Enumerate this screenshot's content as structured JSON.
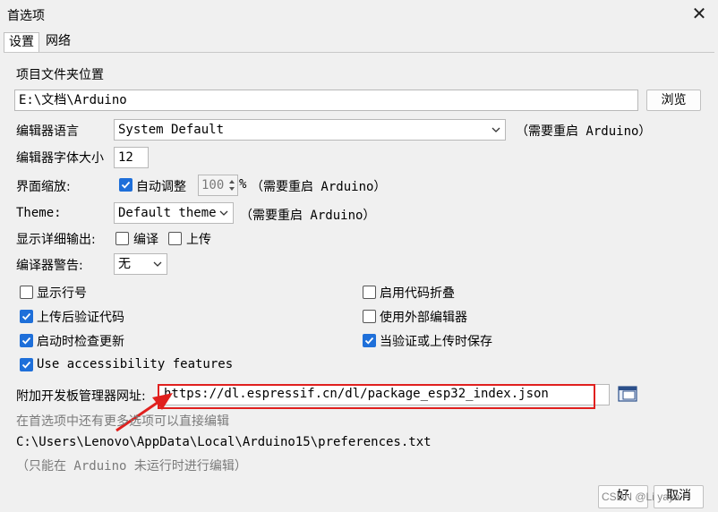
{
  "window": {
    "title": "首选项",
    "close_glyph": "✕"
  },
  "tabs": [
    {
      "label": "设置",
      "active": true
    },
    {
      "label": "网络",
      "active": false
    }
  ],
  "sketchbook": {
    "label": "项目文件夹位置",
    "value": "E:\\文档\\Arduino",
    "browse_label": "浏览"
  },
  "editor_language": {
    "label": "编辑器语言",
    "value": "System Default",
    "note": "（需要重启 Arduino）"
  },
  "editor_font_size": {
    "label": "编辑器字体大小",
    "value": "12"
  },
  "interface_scale": {
    "label": "界面缩放:",
    "auto_label": "自动调整",
    "value": "100",
    "unit": "%",
    "note": "（需要重启 Arduino）"
  },
  "theme": {
    "label": "Theme:",
    "value": "Default theme",
    "note": "（需要重启 Arduino）"
  },
  "verbose": {
    "label": "显示详细输出:",
    "compile_label": "编译",
    "upload_label": "上传"
  },
  "compiler_warnings": {
    "label": "编译器警告:",
    "value": "无"
  },
  "options": {
    "show_line_numbers": "显示行号",
    "enable_code_folding": "启用代码折叠",
    "verify_after_upload": "上传后验证代码",
    "use_external_editor": "使用外部编辑器",
    "check_updates": "启动时检查更新",
    "save_on_verify": "当验证或上传时保存",
    "accessibility": "Use accessibility features"
  },
  "board_urls": {
    "label": "附加开发板管理器网址:",
    "value": "https://dl.espressif.cn/dl/package_esp32_index.json"
  },
  "more_prefs_text": "在首选项中还有更多选项可以直接编辑",
  "prefs_path": "C:\\Users\\Lenovo\\AppData\\Local\\Arduino15\\preferences.txt",
  "edit_note": "（只能在 Arduino 未运行时进行编辑）",
  "footer": {
    "ok_label": "好",
    "cancel_label": "取消",
    "watermark": "CSDN @Li yaya"
  },
  "colors": {
    "accent": "#1e6fd9",
    "highlight": "#e0201e"
  }
}
